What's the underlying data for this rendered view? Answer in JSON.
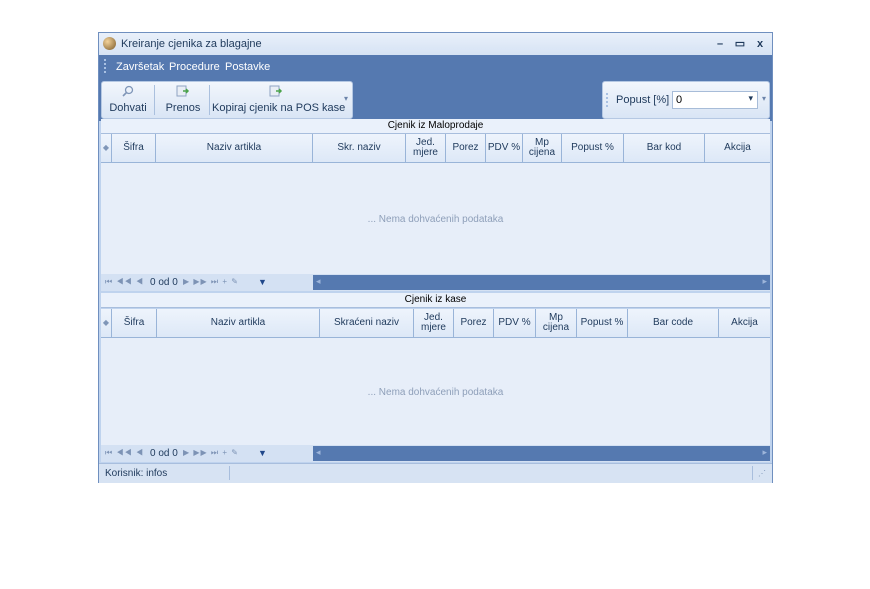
{
  "window": {
    "title": "Kreiranje cjenika za blagajne",
    "minimize": "–",
    "maximize": "▭",
    "close": "x"
  },
  "menu": [
    "Završetak",
    "Procedure",
    "Postavke"
  ],
  "toolbar": {
    "buttons": [
      {
        "label": "Dohvati",
        "icon": "magnifier-icon"
      },
      {
        "label": "Prenos",
        "icon": "transfer-icon"
      },
      {
        "label": "Kopiraj cjenik na POS kase",
        "icon": "copy-icon"
      }
    ],
    "overflow": "▾"
  },
  "popust": {
    "label": "Popust [%]",
    "value": "0",
    "dropdown": "▾"
  },
  "grid1": {
    "title": "Cjenik iz Maloprodaje",
    "columns": [
      "Šifra",
      "Naziv artikla",
      "Skr. naziv",
      "Jed. mjere",
      "Porez",
      "PDV %",
      "Mp cijena",
      "Popust %",
      "Bar kod",
      "Akcija"
    ],
    "empty": "... Nema dohvaćenih podataka",
    "nav_count": "0 od 0"
  },
  "grid2": {
    "title": "Cjenik iz kase",
    "columns": [
      "Šifra",
      "Naziv artikla",
      "Skraćeni naziv",
      "Jed. mjere",
      "Porez",
      "PDV %",
      "Mp cijena",
      "Popust %",
      "Bar code",
      "Akcija"
    ],
    "empty": "... Nema dohvaćenih podataka",
    "nav_count": "0 od 0"
  },
  "status": {
    "user": "Korisnik: infos"
  },
  "colors": {
    "accent": "#5579b0",
    "background": "#bfd3ee",
    "header": "#dde8f7"
  }
}
